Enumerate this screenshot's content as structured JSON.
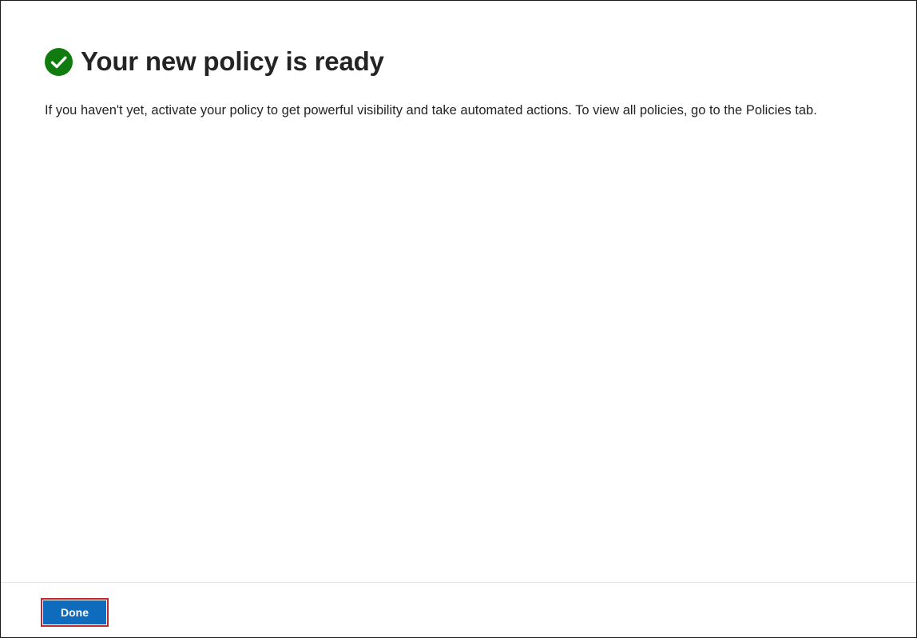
{
  "dialog": {
    "title": "Your new policy is ready",
    "description": "If you haven't yet, activate your policy to get powerful visibility and take automated actions. To view all policies, go to the Policies tab.",
    "status_icon": "checkmark-circle-icon",
    "success_color": "#107c10"
  },
  "footer": {
    "done_label": "Done",
    "button_color": "#0f6cbd",
    "highlight_color": "#c4262e"
  }
}
